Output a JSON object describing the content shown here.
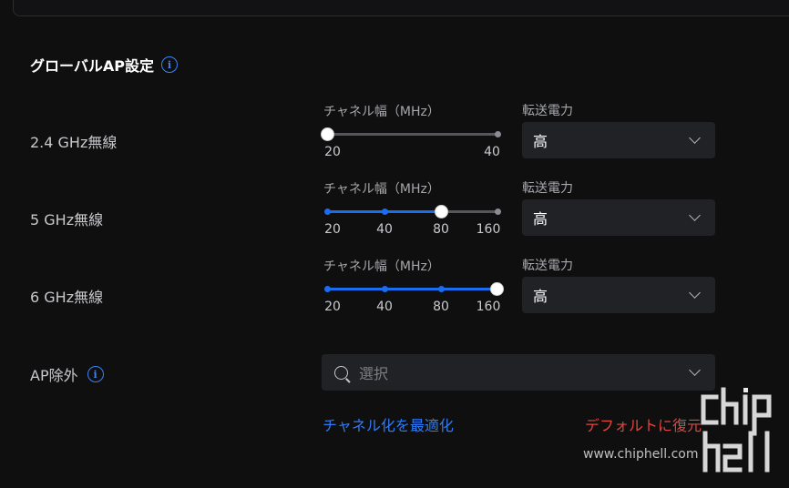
{
  "section": {
    "title": "グローバルAP設定",
    "info_icon": "info-icon"
  },
  "rows": [
    {
      "label": "2.4 GHz無線",
      "width_label": "チャネル幅（MHz）",
      "options": [
        "20",
        "40"
      ],
      "selected": "20",
      "power_label": "転送電力",
      "power_value": "高"
    },
    {
      "label": "5 GHz無線",
      "width_label": "チャネル幅（MHz）",
      "options": [
        "20",
        "40",
        "80",
        "160"
      ],
      "selected": "80",
      "power_label": "転送電力",
      "power_value": "高"
    },
    {
      "label": "6 GHz無線",
      "width_label": "チャネル幅（MHz）",
      "options": [
        "20",
        "40",
        "80",
        "160"
      ],
      "selected": "160",
      "power_label": "転送電力",
      "power_value": "高"
    }
  ],
  "ap_exclusion": {
    "label": "AP除外",
    "placeholder": "選択"
  },
  "actions": {
    "optimize": "チャネル化を最適化",
    "restore": "デフォルトに復元"
  },
  "watermark": {
    "logo_text": "chip hell",
    "url": "www.chiphell.com"
  },
  "colors": {
    "accent": "#1a6cf0",
    "danger": "#e0463e",
    "background": "#0f0f10"
  }
}
